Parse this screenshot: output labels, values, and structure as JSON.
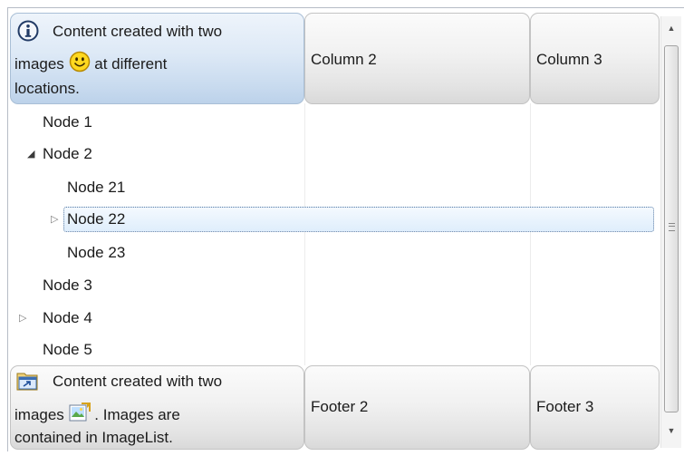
{
  "header": {
    "col1": {
      "line1": "Content created with two",
      "line2a": "images",
      "line2b": "at different",
      "line3": "locations."
    },
    "col2": "Column 2",
    "col3": "Column 3"
  },
  "tree": {
    "nodes": [
      {
        "label": "Node 1"
      },
      {
        "label": "Node 2",
        "expander": "expanded"
      },
      {
        "label": "Node 21"
      },
      {
        "label": "Node 22",
        "expander": "collapsed",
        "selected": true
      },
      {
        "label": "Node 23"
      },
      {
        "label": "Node 3"
      },
      {
        "label": "Node 4",
        "expander": "collapsed"
      },
      {
        "label": "Node 5"
      }
    ]
  },
  "footer": {
    "col1": {
      "line1": "Content created with two",
      "line2a": "images",
      "line2b": ". Images are",
      "line3": "contained in ImageList."
    },
    "col2": "Footer 2",
    "col3": "Footer 3"
  },
  "icons": {
    "header_info": "info-icon",
    "header_smiley": "smiley-icon",
    "footer_window": "window-arrow-icon",
    "footer_image": "image-folder-icon"
  },
  "colors": {
    "selection_border": "#5d7ea6",
    "active_header": "#c9dbef"
  }
}
